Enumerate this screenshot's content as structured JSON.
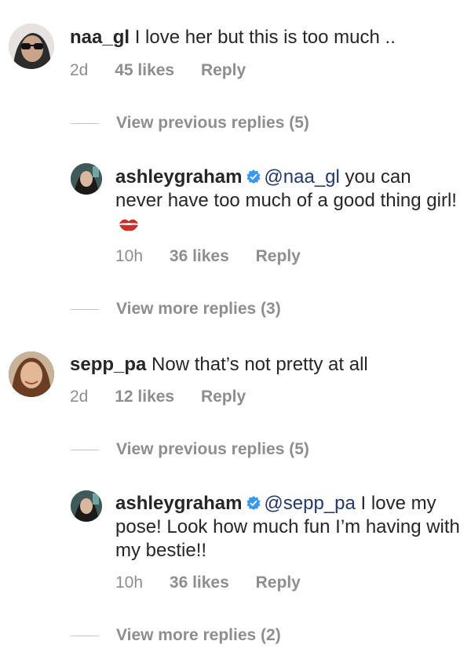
{
  "comments": [
    {
      "username": "naa_gl",
      "text": "I love her but this is too much ..",
      "time": "2d",
      "likes": "45 likes",
      "reply": "Reply",
      "view_replies": "View previous replies (5)",
      "avatar_icon": "avatar-sunglasses-icon"
    },
    {
      "username": "sepp_pa",
      "text": "Now that’s not pretty at all",
      "time": "2d",
      "likes": "12 likes",
      "reply": "Reply",
      "view_replies": "View previous replies (5)",
      "avatar_icon": "avatar-woman-icon"
    }
  ],
  "replies": [
    {
      "username": "ashleygraham",
      "mention": "@naa_gl",
      "text": "you can never have too much of a good thing girl!",
      "emoji": "kiss-mark-icon",
      "time": "10h",
      "likes": "36 likes",
      "reply": "Reply",
      "view_more": "View more replies (3)"
    },
    {
      "username": "ashleygraham",
      "mention": "@sepp_pa",
      "text": "I love my pose! Look how much fun I’m having with my bestie!!",
      "time": "10h",
      "likes": "36 likes",
      "reply": "Reply",
      "view_more": "View more replies (2)"
    }
  ],
  "colors": {
    "text": "#262626",
    "secondary": "#8e8e8e",
    "mention": "#23386e",
    "verified": "#3897f0",
    "kiss": "#c9302c"
  }
}
